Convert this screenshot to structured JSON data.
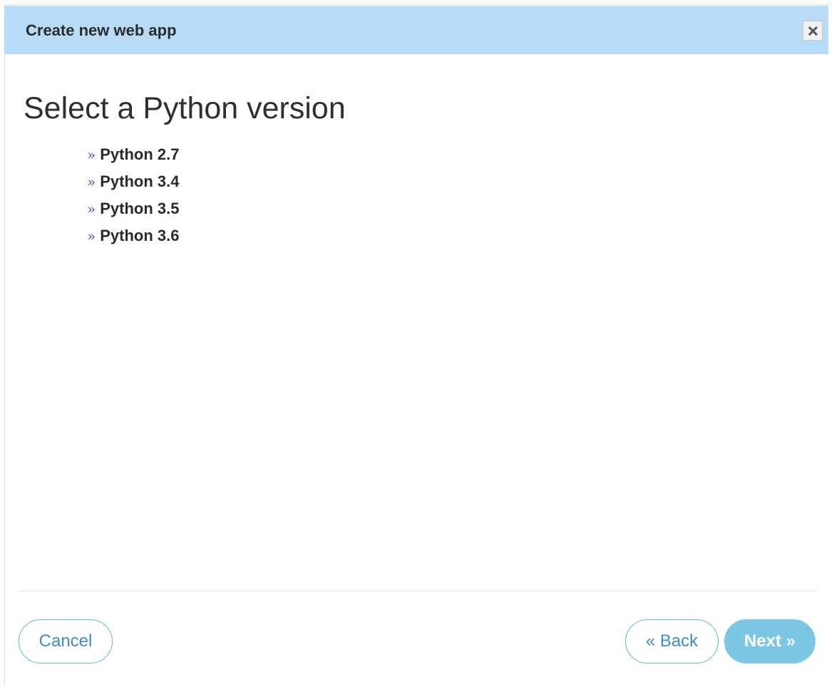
{
  "dialog": {
    "title": "Create new web app",
    "close_icon": "close-icon"
  },
  "main": {
    "heading": "Select a Python version",
    "bullet_glyph": "»",
    "versions": [
      {
        "label": "Python 2.7"
      },
      {
        "label": "Python 3.4"
      },
      {
        "label": "Python 3.5"
      },
      {
        "label": "Python 3.6"
      }
    ]
  },
  "footer": {
    "cancel_label": "Cancel",
    "back_label": "« Back",
    "next_label": "Next »"
  },
  "colors": {
    "header_bg": "#b8dcf7",
    "link_accent": "#3d57b5",
    "button_outline": "#5ab6dc",
    "button_primary": "#7cc6e6"
  }
}
